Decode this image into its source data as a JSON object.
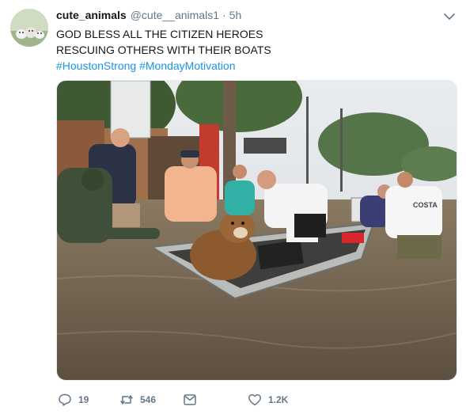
{
  "tweet": {
    "display_name": "cute_animals",
    "handle": "@cute__animals1",
    "separator": "·",
    "time": "5h",
    "text_line1": "GOD BLESS ALL THE CITIZEN HEROES",
    "text_line2": "RESCUING OTHERS WITH THEIR BOATS",
    "hashtag1": "#HoustonStrong",
    "hashtag2": "#MondayMotivation"
  },
  "media": {
    "sign_text": "COSTA"
  },
  "actions": {
    "reply_count": "19",
    "retweet_count": "546",
    "like_count": "1.2K"
  },
  "icons": {
    "reply": "reply-icon",
    "retweet": "retweet-icon",
    "dm": "direct-message-icon",
    "like": "heart-icon",
    "caret": "chevron-down-icon"
  },
  "colors": {
    "link": "#1b95e0",
    "muted": "#657786",
    "text": "#14171a"
  }
}
